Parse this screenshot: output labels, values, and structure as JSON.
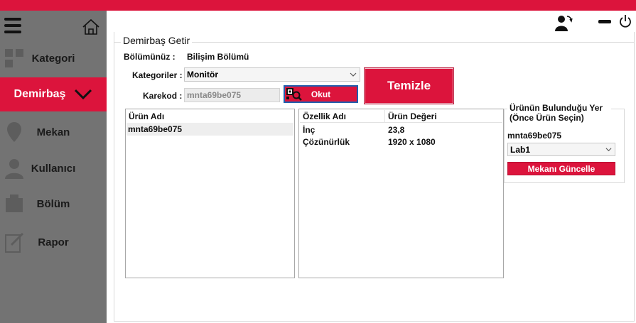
{
  "colors": {
    "accent": "#dc143c",
    "sidebar": "#737373"
  },
  "sidebar": {
    "items": [
      {
        "label": "Kategori",
        "icon": "category-icon"
      },
      {
        "label": "Demirbaş",
        "icon": "chevron-down-icon",
        "active": true
      },
      {
        "label": "Mekan",
        "icon": "location-icon"
      },
      {
        "label": "Kullanıcı",
        "icon": "user-icon"
      },
      {
        "label": "Bölüm",
        "icon": "department-icon"
      },
      {
        "label": "Rapor",
        "icon": "report-icon"
      }
    ]
  },
  "header": {
    "icons": [
      "menu-icon",
      "home-icon",
      "switch-user-icon",
      "minimize-icon",
      "power-icon"
    ]
  },
  "form": {
    "title": "Demirbaş Getir",
    "bolum_label": "Bölümünüz :",
    "bolum_value": "Bilişim Bölümü",
    "kategori_label": "Kategoriler :",
    "kategori_value": "Monitör",
    "karekod_label": "Karekod :",
    "karekod_value": "mnta69be075",
    "okut_label": "Okut",
    "temizle_label": "Temizle"
  },
  "urun_list": {
    "header": "Ürün Adı",
    "items": [
      "mnta69be075"
    ]
  },
  "ozellik_table": {
    "columns": [
      "Özellik Adı",
      "Ürün Değeri"
    ],
    "rows": [
      [
        "İnç",
        "23,8"
      ],
      [
        "Çözünürlük",
        "1920 x 1080"
      ]
    ]
  },
  "location": {
    "title": "Ürünün Bulunduğu Yer (Önce Ürün Seçin)",
    "code": "mnta69be075",
    "selected": "Lab1",
    "button": "Mekanı Güncelle"
  }
}
